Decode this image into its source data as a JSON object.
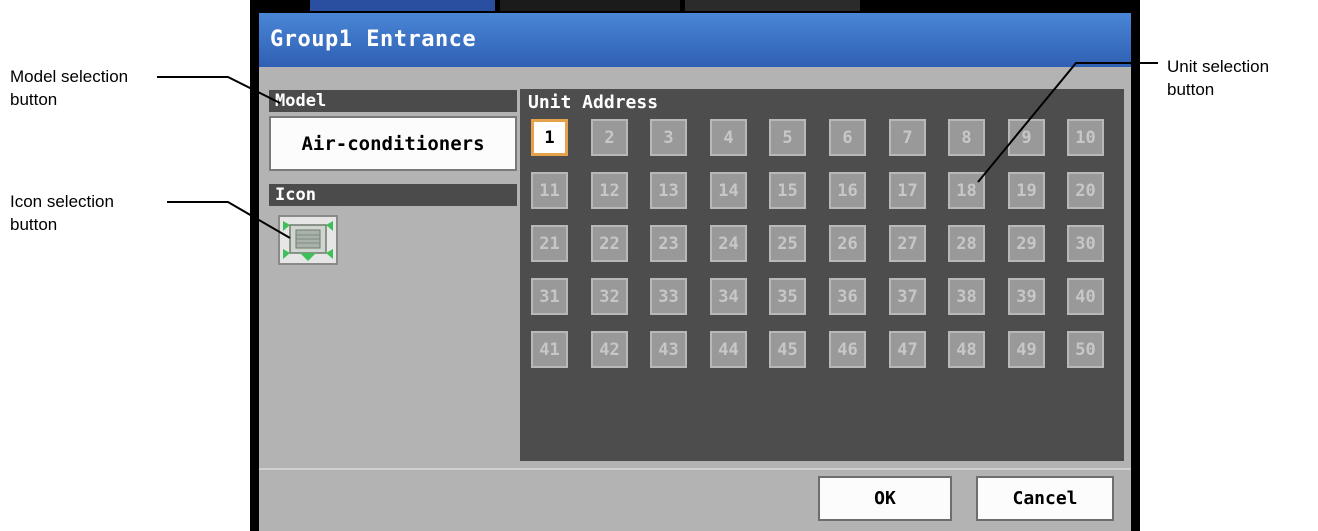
{
  "window": {
    "title": "Group1 Entrance"
  },
  "model": {
    "heading": "Model",
    "button_label": "Air-conditioners"
  },
  "icon": {
    "heading": "Icon",
    "selected_icon": "ceiling-cassette-unit-icon"
  },
  "unit_address": {
    "heading": "Unit Address",
    "selected": "1",
    "units": [
      "1",
      "2",
      "3",
      "4",
      "5",
      "6",
      "7",
      "8",
      "9",
      "10",
      "11",
      "12",
      "13",
      "14",
      "15",
      "16",
      "17",
      "18",
      "19",
      "20",
      "21",
      "22",
      "23",
      "24",
      "25",
      "26",
      "27",
      "28",
      "29",
      "30",
      "31",
      "32",
      "33",
      "34",
      "35",
      "36",
      "37",
      "38",
      "39",
      "40",
      "41",
      "42",
      "43",
      "44",
      "45",
      "46",
      "47",
      "48",
      "49",
      "50"
    ]
  },
  "buttons": {
    "ok": "OK",
    "cancel": "Cancel"
  },
  "callouts": {
    "model": [
      "Model selection",
      "button"
    ],
    "icon": [
      "Icon selection",
      "button"
    ],
    "unit": [
      "Unit selection",
      "button"
    ]
  },
  "colors": {
    "title_bar": "#3a6fc4",
    "panel_dark": "#4d4d4d",
    "window_bg": "#b3b3b3",
    "selected_border": "#e6a24a"
  }
}
